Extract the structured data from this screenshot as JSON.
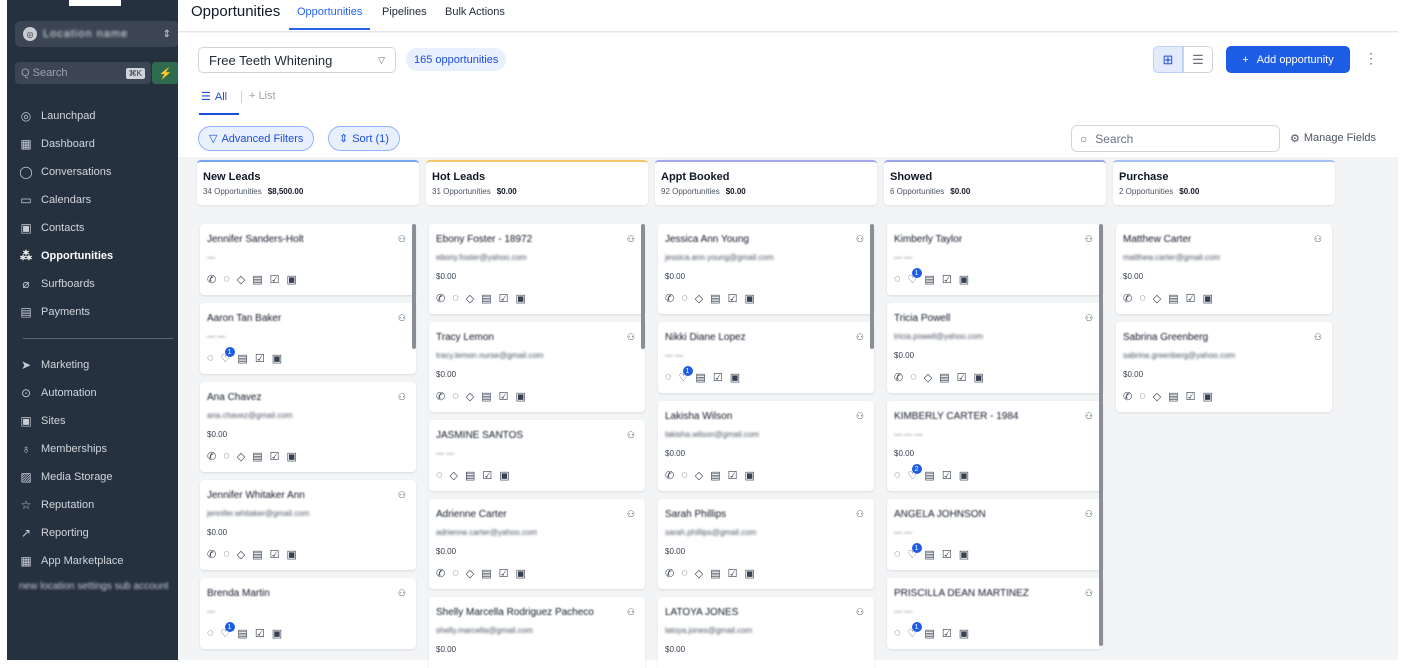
{
  "page": {
    "title": "Opportunities"
  },
  "tabs": [
    {
      "label": "Opportunities"
    },
    {
      "label": "Pipelines"
    },
    {
      "label": "Bulk Actions"
    }
  ],
  "sidebar": {
    "account_name": "Location name",
    "search_placeholder": "Q Search",
    "search_shortcut": "⌘K",
    "nav_items": [
      {
        "label": "Launchpad",
        "icon": "rocket-icon"
      },
      {
        "label": "Dashboard",
        "icon": "grid-icon"
      },
      {
        "label": "Conversations",
        "icon": "chat-icon"
      },
      {
        "label": "Calendars",
        "icon": "calendar-icon"
      },
      {
        "label": "Contacts",
        "icon": "contact-card-icon"
      },
      {
        "label": "Opportunities",
        "icon": "funnel-icon"
      },
      {
        "label": "Surfboards",
        "icon": "surfboard-icon"
      },
      {
        "label": "Payments",
        "icon": "receipt-icon"
      },
      {
        "label": "Marketing",
        "icon": "send-icon"
      },
      {
        "label": "Automation",
        "icon": "automation-icon"
      },
      {
        "label": "Sites",
        "icon": "globe-icon"
      },
      {
        "label": "Memberships",
        "icon": "trophy-icon"
      },
      {
        "label": "Media Storage",
        "icon": "image-icon"
      },
      {
        "label": "Reputation",
        "icon": "star-icon"
      },
      {
        "label": "Reporting",
        "icon": "trend-icon"
      },
      {
        "label": "App Marketplace",
        "icon": "apps-icon"
      }
    ],
    "footer_text": "new location settings sub account"
  },
  "toolbar": {
    "pipeline_value": "Free Teeth Whitening",
    "count_label": "165 opportunities",
    "add_label": "Add opportunity",
    "subtab_all": "All",
    "subtab_list": "+ List",
    "advanced_filters": "Advanced Filters",
    "sort_label": "Sort (1)",
    "search_placeholder": "Search",
    "manage_fields": "Manage Fields"
  },
  "colors": {
    "accent": "#1d5ce5",
    "new_leads": "#7aa5f5",
    "hot_leads": "#f4c76b",
    "appt_booked": "#a5a8ec",
    "showed": "#9aa6e8",
    "purchase": "#a6c2f5"
  },
  "columns": [
    {
      "name": "New Leads",
      "count": "34 Opportunities",
      "total": "$8,500.00",
      "cards": [
        {
          "name": "Jennifer Sanders-Holt",
          "sub": "—",
          "value": "",
          "icons": [
            "phone",
            "chat",
            "tag",
            "doc",
            "check",
            "calendar"
          ],
          "badge": ""
        },
        {
          "name": "Aaron Tan Baker",
          "sub": "— —",
          "value": "",
          "icons": [
            "chat",
            "heart",
            "doc",
            "check",
            "calendar"
          ],
          "badge": "1"
        },
        {
          "name": "Ana Chavez",
          "sub": "ana.chavez@gmail.com",
          "value": "$0.00",
          "icons": [
            "phone",
            "chat",
            "tag",
            "doc",
            "check",
            "calendar"
          ],
          "badge": ""
        },
        {
          "name": "Jennifer Whitaker Ann",
          "sub": "jennifer.whitaker@gmail.com",
          "value": "$0.00",
          "icons": [
            "phone",
            "chat",
            "tag",
            "doc",
            "check",
            "calendar"
          ],
          "badge": ""
        },
        {
          "name": "Brenda Martin",
          "sub": "—",
          "value": "",
          "icons": [
            "chat",
            "heart",
            "doc",
            "check",
            "calendar"
          ],
          "badge": "1"
        }
      ]
    },
    {
      "name": "Hot Leads",
      "count": "31 Opportunities",
      "total": "$0.00",
      "cards": [
        {
          "name": "Ebony Foster - 18972",
          "sub": "ebony.foster@yahoo.com",
          "value": "$0.00",
          "icons": [
            "phone",
            "chat",
            "tag",
            "doc",
            "check",
            "calendar"
          ],
          "badge": ""
        },
        {
          "name": "Tracy Lemon",
          "sub": "tracy.lemon.nurse@gmail.com",
          "value": "$0.00",
          "icons": [
            "phone",
            "chat",
            "tag",
            "doc",
            "check",
            "calendar"
          ],
          "badge": ""
        },
        {
          "name": "JASMINE SANTOS",
          "sub": "— —",
          "value": "",
          "icons": [
            "chat",
            "tag",
            "doc",
            "check",
            "calendar"
          ],
          "badge": ""
        },
        {
          "name": "Adrienne Carter",
          "sub": "adrienne.carter@yahoo.com",
          "value": "$0.00",
          "icons": [
            "phone",
            "chat",
            "tag",
            "doc",
            "check",
            "calendar"
          ],
          "badge": ""
        },
        {
          "name": "Shelly Marcella Rodriguez Pacheco",
          "sub": "shelly.marcella@gmail.com",
          "value": "$0.00",
          "icons": [],
          "badge": ""
        }
      ]
    },
    {
      "name": "Appt Booked",
      "count": "92 Opportunities",
      "total": "$0.00",
      "cards": [
        {
          "name": "Jessica Ann Young",
          "sub": "jessica.ann.young@gmail.com",
          "value": "$0.00",
          "icons": [
            "phone",
            "chat",
            "tag",
            "doc",
            "check",
            "calendar"
          ],
          "badge": ""
        },
        {
          "name": "Nikki Diane Lopez",
          "sub": "— —",
          "value": "",
          "icons": [
            "chat",
            "heart",
            "doc",
            "check",
            "calendar"
          ],
          "badge": "1"
        },
        {
          "name": "Lakisha Wilson",
          "sub": "lakisha.wilson@gmail.com",
          "value": "$0.00",
          "icons": [
            "phone",
            "chat",
            "tag",
            "doc",
            "check",
            "calendar"
          ],
          "badge": ""
        },
        {
          "name": "Sarah Phillips",
          "sub": "sarah.phillips@gmail.com",
          "value": "$0.00",
          "icons": [
            "phone",
            "chat",
            "tag",
            "doc",
            "check",
            "calendar"
          ],
          "badge": ""
        },
        {
          "name": "LATOYA JONES",
          "sub": "latoya.jones@gmail.com",
          "value": "$0.00",
          "icons": [],
          "badge": ""
        }
      ]
    },
    {
      "name": "Showed",
      "count": "6 Opportunities",
      "total": "$0.00",
      "cards": [
        {
          "name": "Kimberly Taylor",
          "sub": "— —",
          "value": "",
          "icons": [
            "chat",
            "heart",
            "doc",
            "check",
            "calendar"
          ],
          "badge": "1"
        },
        {
          "name": "Tricia Powell",
          "sub": "tricia.powell@yahoo.com",
          "value": "$0.00",
          "icons": [
            "phone",
            "chat",
            "tag",
            "doc",
            "check",
            "calendar"
          ],
          "badge": ""
        },
        {
          "name": "KIMBERLY CARTER - 1984",
          "sub": "— — —",
          "value": "$0.00",
          "icons": [
            "chat",
            "heart",
            "doc",
            "check",
            "calendar"
          ],
          "badge": "2"
        },
        {
          "name": "ANGELA JOHNSON",
          "sub": "— —",
          "value": "",
          "icons": [
            "chat",
            "heart",
            "doc",
            "check",
            "calendar"
          ],
          "badge": "1"
        },
        {
          "name": "PRISCILLA DEAN MARTINEZ",
          "sub": "— —",
          "value": "",
          "icons": [
            "chat",
            "heart",
            "doc",
            "check",
            "calendar"
          ],
          "badge": "1"
        }
      ]
    },
    {
      "name": "Purchase",
      "count": "2 Opportunities",
      "total": "$0.00",
      "cards": [
        {
          "name": "Matthew Carter",
          "sub": "matthew.carter@gmail.com",
          "value": "$0.00",
          "icons": [
            "phone",
            "chat",
            "tag",
            "doc",
            "check",
            "calendar"
          ],
          "badge": ""
        },
        {
          "name": "Sabrina Greenberg",
          "sub": "sabrina.greenberg@yahoo.com",
          "value": "$0.00",
          "icons": [
            "phone",
            "chat",
            "tag",
            "doc",
            "check",
            "calendar"
          ],
          "badge": ""
        }
      ]
    }
  ]
}
